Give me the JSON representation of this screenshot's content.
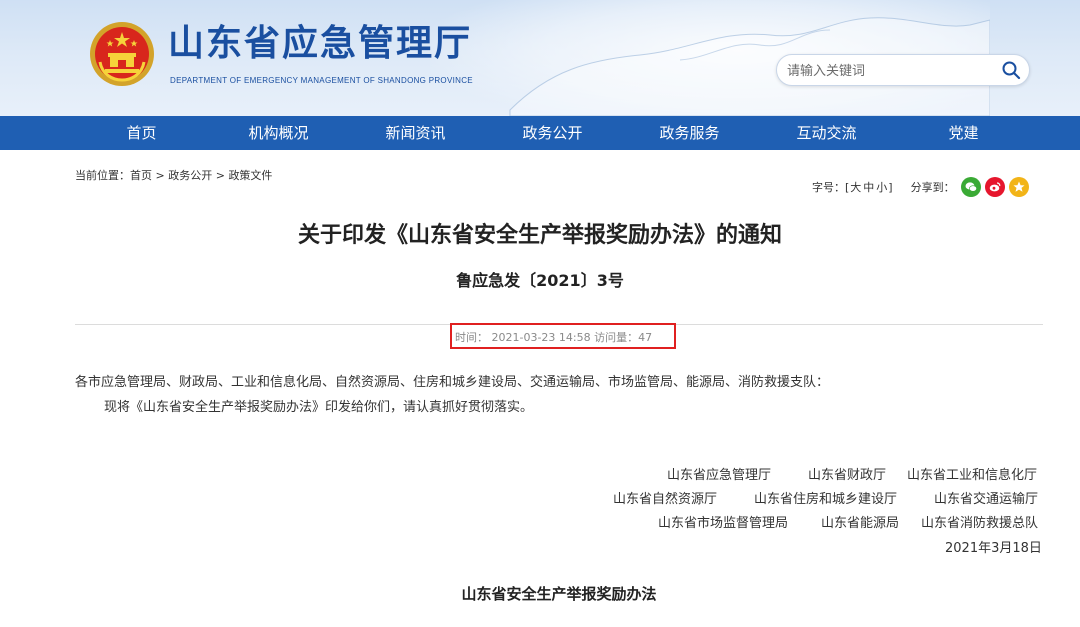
{
  "header": {
    "title": "山东省应急管理厅",
    "subtitle": "DEPARTMENT OF EMERGENCY MANAGEMENT OF SHANDONG PROVINCE",
    "search_placeholder": "请输入关键词",
    "brand_color": "#1a4fa0",
    "icons": {
      "emblem": "national-emblem-icon",
      "search": "search-icon"
    }
  },
  "nav": {
    "items": [
      "首页",
      "机构概况",
      "新闻资讯",
      "政务公开",
      "政务服务",
      "互动交流",
      "党建"
    ],
    "background": "#1f5fb3"
  },
  "breadcrumb": {
    "prefix": "当前位置：",
    "items": [
      "首页",
      "政务公开",
      "政策文件"
    ],
    "separator": " > "
  },
  "tools": {
    "font_size_label": "字号：[",
    "sizes": [
      "大",
      "中",
      "小"
    ],
    "close_bracket": "]",
    "share_label": "分享到：",
    "share_icons": [
      "wechat-icon",
      "weibo-icon",
      "favorite-icon"
    ]
  },
  "article": {
    "title": "关于印发《山东省安全生产举报奖励办法》的通知",
    "doc_number": "鲁应急发〔2021〕3号",
    "meta": "时间：  2021-03-23 14:58 访问量：47",
    "highlight_color": "#e02020",
    "recipients": "各市应急管理局、财政局、工业和信息化局、自然资源局、住房和城乡建设局、交通运输局、市场监管局、能源局、消防救援支队：",
    "body": "现将《山东省安全生产举报奖励办法》印发给你们，请认真抓好贯彻落实。",
    "signatories": [
      [
        "山东省应急管理厅",
        "山东省财政厅",
        "山东省工业和信息化厅"
      ],
      [
        "山东省自然资源厅",
        "山东省住房和城乡建设厅",
        "山东省交通运输厅"
      ],
      [
        "山东省市场监督管理局",
        "山东省能源局",
        "山东省消防救援总队"
      ]
    ],
    "date": "2021年3月18日",
    "attachment_title": "山东省安全生产举报奖励办法"
  }
}
